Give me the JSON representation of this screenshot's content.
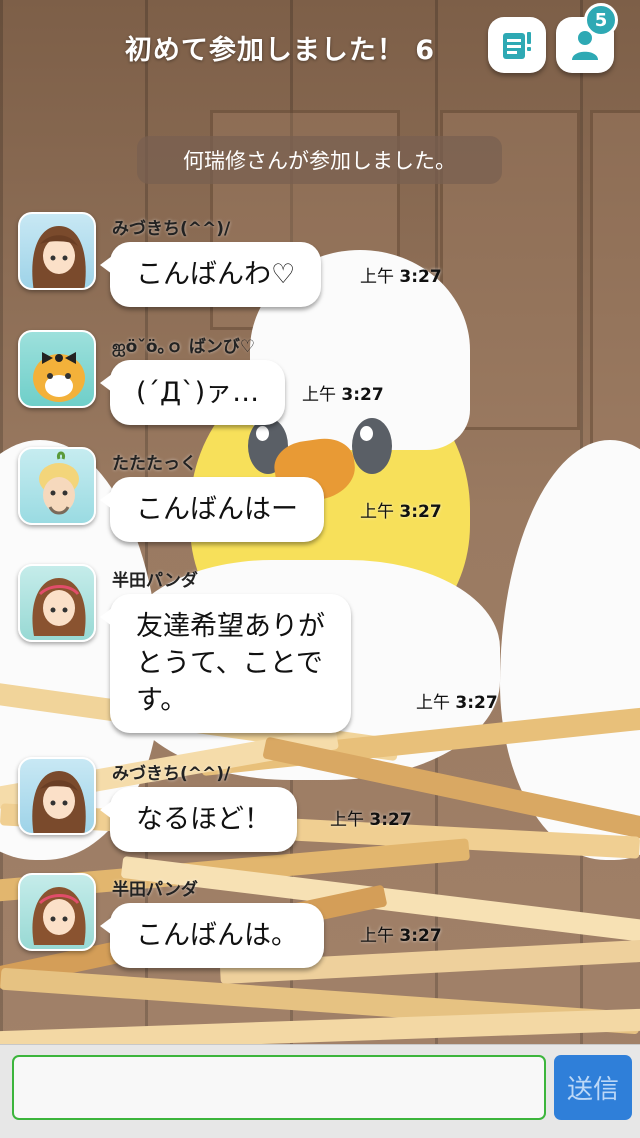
{
  "header": {
    "title": "初めて参加しました！ 6",
    "members_badge": "5"
  },
  "notice": "何瑞修さんが参加しました。",
  "messages": [
    {
      "sender": "みづきち(^^)/",
      "text": "こんばんわ♡",
      "ts_prefix": "上午",
      "ts_time": "3:27"
    },
    {
      "sender": "ஐöˇö｡ｏ ばンび♡",
      "text": "(´Д`)ァ…",
      "ts_prefix": "上午",
      "ts_time": "3:27"
    },
    {
      "sender": "たたたっく",
      "text": "こんばんはー",
      "ts_prefix": "上午",
      "ts_time": "3:27"
    },
    {
      "sender": "半田パンダ",
      "text": "友達希望ありが\nとうて、ことで\nす。",
      "ts_prefix": "上午",
      "ts_time": "3:27"
    },
    {
      "sender": "みづきち(^^)/",
      "text": "なるほど！",
      "ts_prefix": "上午",
      "ts_time": "3:27"
    },
    {
      "sender": "半田パンダ",
      "text": "こんばんは。",
      "ts_prefix": "上午",
      "ts_time": "3:27"
    }
  ],
  "input": {
    "value": "",
    "placeholder": ""
  },
  "send_label": "送信",
  "icons": {
    "memo": "memo-icon",
    "members": "person-icon"
  },
  "colors": {
    "accent": "#2ea9b4",
    "send": "#2f7fd9",
    "input_border": "#3cb53c"
  }
}
